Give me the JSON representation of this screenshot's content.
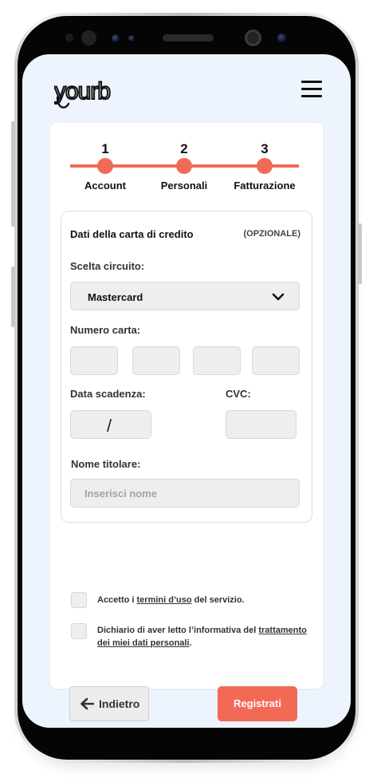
{
  "header": {
    "logo_text": "yourb",
    "menu_icon": "hamburger-menu-icon"
  },
  "steps": {
    "items": [
      {
        "number": "1",
        "label": "Account"
      },
      {
        "number": "2",
        "label": "Personali"
      },
      {
        "number": "3",
        "label": "Fatturazione"
      }
    ]
  },
  "card_section": {
    "title": "Dati della carta di credito",
    "optional_badge": "(OPZIONALE)",
    "circuit": {
      "label": "Scelta circuito:",
      "selected": "Mastercard",
      "icon": "chevron-down-icon"
    },
    "card_number": {
      "label": "Numero carta:",
      "groups": [
        "",
        "",
        "",
        ""
      ]
    },
    "expiry": {
      "label": "Data scadenza:",
      "separator": "/"
    },
    "cvc": {
      "label": "CVC:"
    },
    "holder": {
      "label": "Nome titolare:",
      "placeholder": "Inserisci nome"
    }
  },
  "consents": {
    "terms": {
      "prefix": "Accetto i ",
      "link": "termini d’uso",
      "suffix": " del servizio.",
      "checked": false
    },
    "privacy": {
      "prefix": "Dichiario di aver letto l’informativa del ",
      "link_line1": "trattamento",
      "link_line2": "dei miei dati personali",
      "suffix": ".",
      "checked": false
    }
  },
  "actions": {
    "back_label": "Indietro",
    "back_icon": "arrow-left-icon",
    "register_label": "Registrati"
  },
  "colors": {
    "accent": "#f26a56",
    "screen_background": "#edf4fd",
    "field_background": "#eeeeee"
  }
}
